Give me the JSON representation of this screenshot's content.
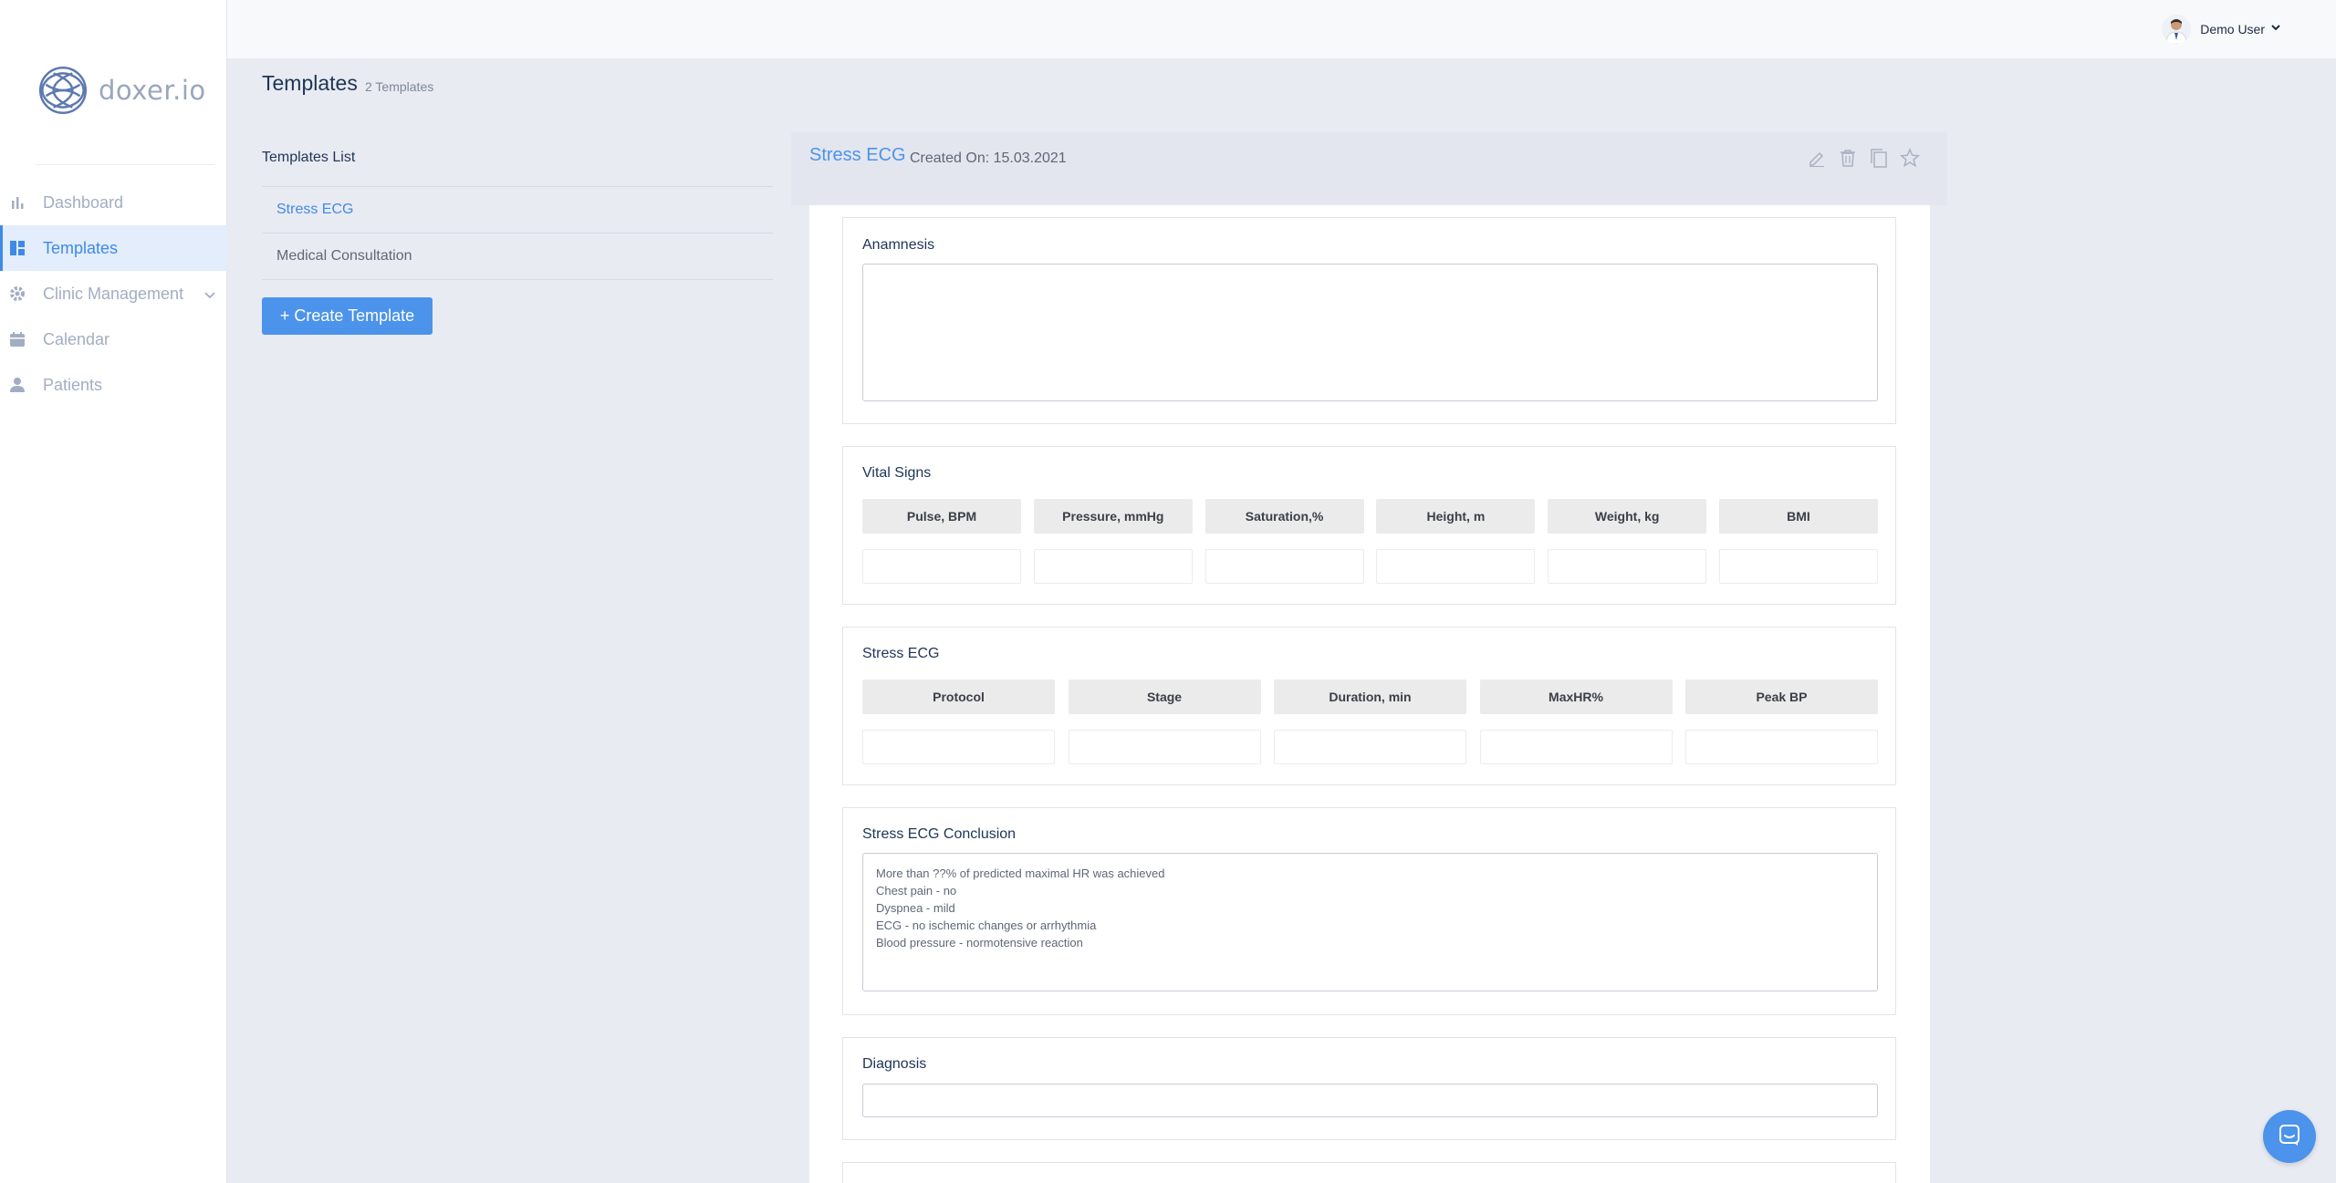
{
  "brand": {
    "name": "doxer.io"
  },
  "sidebar": {
    "items": [
      {
        "label": "Dashboard",
        "icon": "bar-chart-icon",
        "active": false
      },
      {
        "label": "Templates",
        "icon": "template-icon",
        "active": true
      },
      {
        "label": "Clinic Management",
        "icon": "gear-icon",
        "active": false,
        "expandable": true
      },
      {
        "label": "Calendar",
        "icon": "calendar-icon",
        "active": false
      },
      {
        "label": "Patients",
        "icon": "person-icon",
        "active": false
      }
    ]
  },
  "topbar": {
    "user_name": "Demo User"
  },
  "page": {
    "title": "Templates",
    "count": "2 Templates"
  },
  "templates_list": {
    "title": "Templates List",
    "items": [
      "Stress ECG",
      "Medical Consultation"
    ],
    "create_label": "+ Create Template"
  },
  "template": {
    "name": "Stress ECG",
    "created": "Created On: 15.03.2021",
    "sections": {
      "anamnesis": {
        "title": "Anamnesis"
      },
      "vital_signs": {
        "title": "Vital Signs",
        "columns": [
          "Pulse, BPM",
          "Pressure, mmHg",
          "Saturation,%",
          "Height, m",
          "Weight, kg",
          "BMI"
        ]
      },
      "stress_ecg": {
        "title": "Stress ECG",
        "columns": [
          "Protocol",
          "Stage",
          "Duration, min",
          "MaxHR%",
          "Peak  BP"
        ]
      },
      "conclusion": {
        "title": "Stress ECG Conclusion",
        "lines": [
          "More than ??% of predicted maximal HR was achieved",
          "Chest pain - no",
          "Dyspnea - mild",
          "ECG - no ischemic changes or arrhythmia",
          "Blood pressure - normotensive reaction"
        ]
      },
      "diagnosis": {
        "title": "Diagnosis"
      }
    }
  },
  "colors": {
    "accent": "#4b93eb",
    "sidebar_active_bg": "#e3edfb",
    "page_bg": "#e9ebf2"
  }
}
